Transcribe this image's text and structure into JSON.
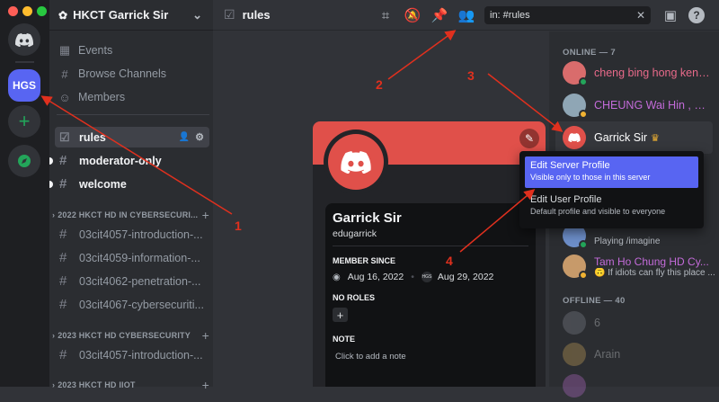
{
  "server": {
    "name": "HKCT Garrick Sir",
    "rail_label": "HGS"
  },
  "nav": {
    "events": "Events",
    "browse": "Browse Channels",
    "members": "Members"
  },
  "channels": [
    {
      "name": "rules"
    },
    {
      "name": "moderator-only"
    },
    {
      "name": "welcome"
    }
  ],
  "categories": [
    {
      "name": "2022 HKCT HD IN CYBERSECURI...",
      "channels": [
        "03cit4057-introduction-...",
        "03cit4059-information-...",
        "03cit4062-penetration-...",
        "03cit4067-cybersecuriti..."
      ]
    },
    {
      "name": "2023 HKCT HD CYBERSECURITY",
      "channels": [
        "03cit4057-introduction-..."
      ]
    },
    {
      "name": "2023 HKCT HD IIOT",
      "channels": []
    }
  ],
  "topbar": {
    "channel": "rules",
    "search_value": "in: #rules"
  },
  "profile": {
    "name": "Garrick Sir",
    "username": "edugarrick",
    "member_since_label": "MEMBER SINCE",
    "discord_date": "Aug 16, 2022",
    "server_date": "Aug 29, 2022",
    "server_tag": "HGS",
    "no_roles": "NO ROLES",
    "note_label": "NOTE",
    "note_placeholder": "Click to add a note"
  },
  "members": {
    "online_header": "ONLINE — 7",
    "offline_header": "OFFLINE — 40",
    "online": [
      {
        "name": "cheng bing hong kent,...",
        "color": "#e86a8a"
      },
      {
        "name": "CHEUNG Wai Hin , HD...",
        "color": "#c36bd9"
      },
      {
        "name": "Garrick Sir",
        "color": "#ffffff"
      },
      {
        "name": "Playing /imagine",
        "color": "#b5bac1"
      },
      {
        "name": "Tam Ho Chung HD Cy...",
        "status": "If idiots can fly this place ...",
        "color": "#c36bd9"
      }
    ],
    "offline": [
      {
        "name": "6"
      },
      {
        "name": "Arain"
      }
    ]
  },
  "context_menu": {
    "items": [
      {
        "title": "Edit Server Profile",
        "sub": "Visible only to those in this server"
      },
      {
        "title": "Edit User Profile",
        "sub": "Default profile and visible to everyone"
      }
    ]
  },
  "annotations": [
    "1",
    "2",
    "3",
    "4"
  ],
  "colors": {
    "accent": "#5865f2",
    "banner": "#e0504a",
    "arrow": "#e0301e"
  }
}
